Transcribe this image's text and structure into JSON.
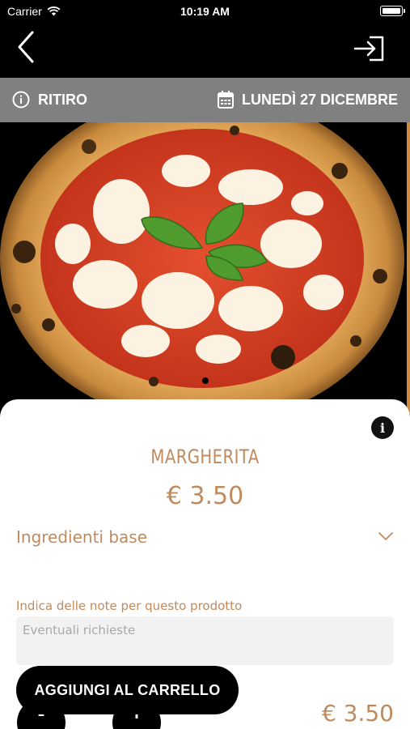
{
  "status_bar": {
    "carrier": "Carrier",
    "time": "10:19 AM"
  },
  "order_bar": {
    "mode_label": "RITIRO",
    "date_label": "LUNEDÌ 27 DICEMBRE"
  },
  "hero": {
    "image_subject": "pizza-margherita-photo",
    "page_indicator": {
      "count": 1,
      "current": 1
    }
  },
  "product": {
    "name": "MARGHERITA",
    "price": "€ 3.50",
    "ingredients_label": "Ingredienti base",
    "notes_label": "Indica delle note per questo prodotto",
    "notes_placeholder": "Eventuali richieste",
    "notes_value": ""
  },
  "actions": {
    "add_to_cart_label": "AGGIUNGI AL CARRELLO",
    "minus_label": "-",
    "plus_label": "+",
    "total_price": "€ 3.50"
  },
  "colors": {
    "accent": "#c08a5c",
    "info_bar": "#808080",
    "background": "#000000"
  }
}
